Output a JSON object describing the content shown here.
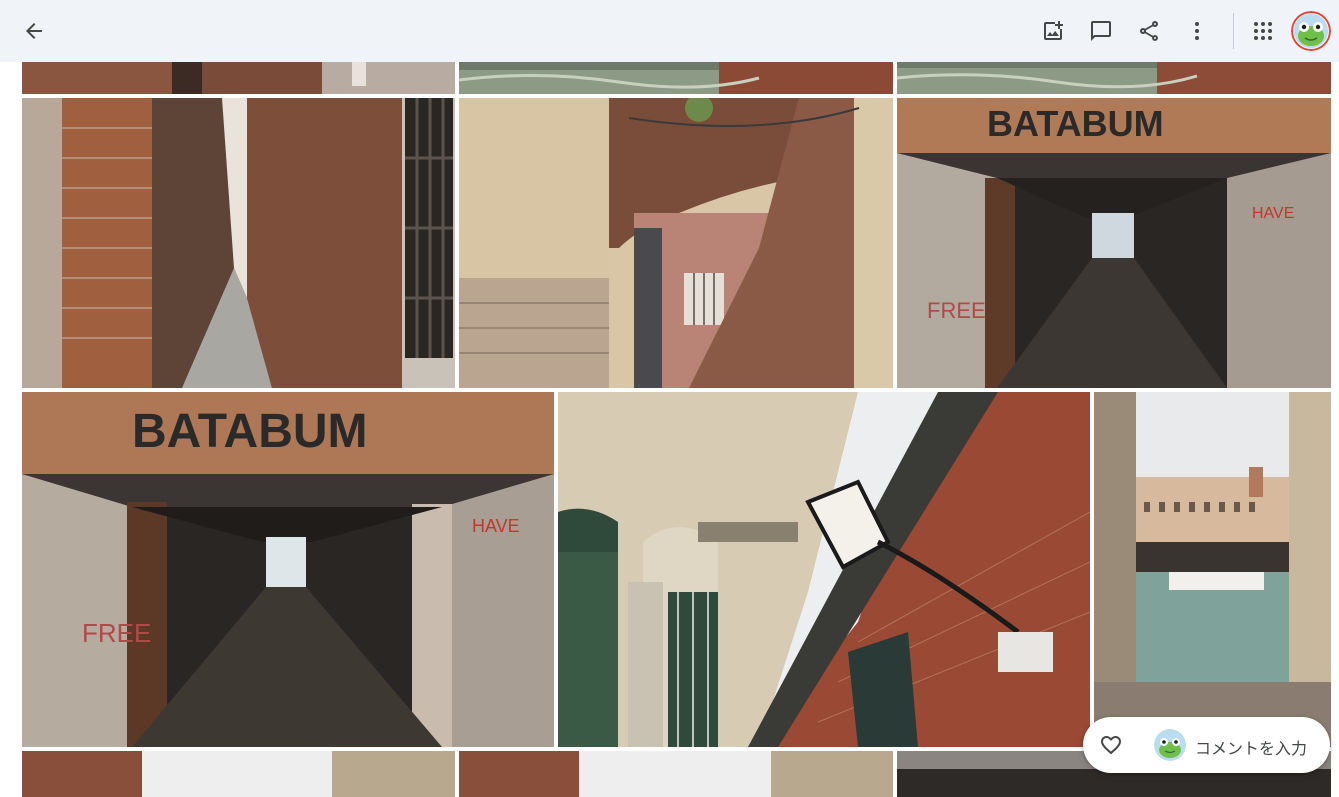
{
  "topbar": {
    "back_icon": "arrow-back-icon",
    "actions": [
      {
        "name": "add-to-album-icon"
      },
      {
        "name": "comment-icon"
      },
      {
        "name": "share-icon"
      },
      {
        "name": "more-vert-icon"
      }
    ],
    "apps_icon": "apps-grid-icon",
    "avatar": "frog-avatar"
  },
  "photos": {
    "graffiti_text": "BATABUM",
    "graffiti_text_2": "BATABUM"
  },
  "comment": {
    "like_icon": "heart-outline-icon",
    "placeholder": "コメントを入力"
  },
  "colors": {
    "topbar_bg": "#f0f4f9",
    "icon": "#444746",
    "page_bg": "#ffffff"
  }
}
